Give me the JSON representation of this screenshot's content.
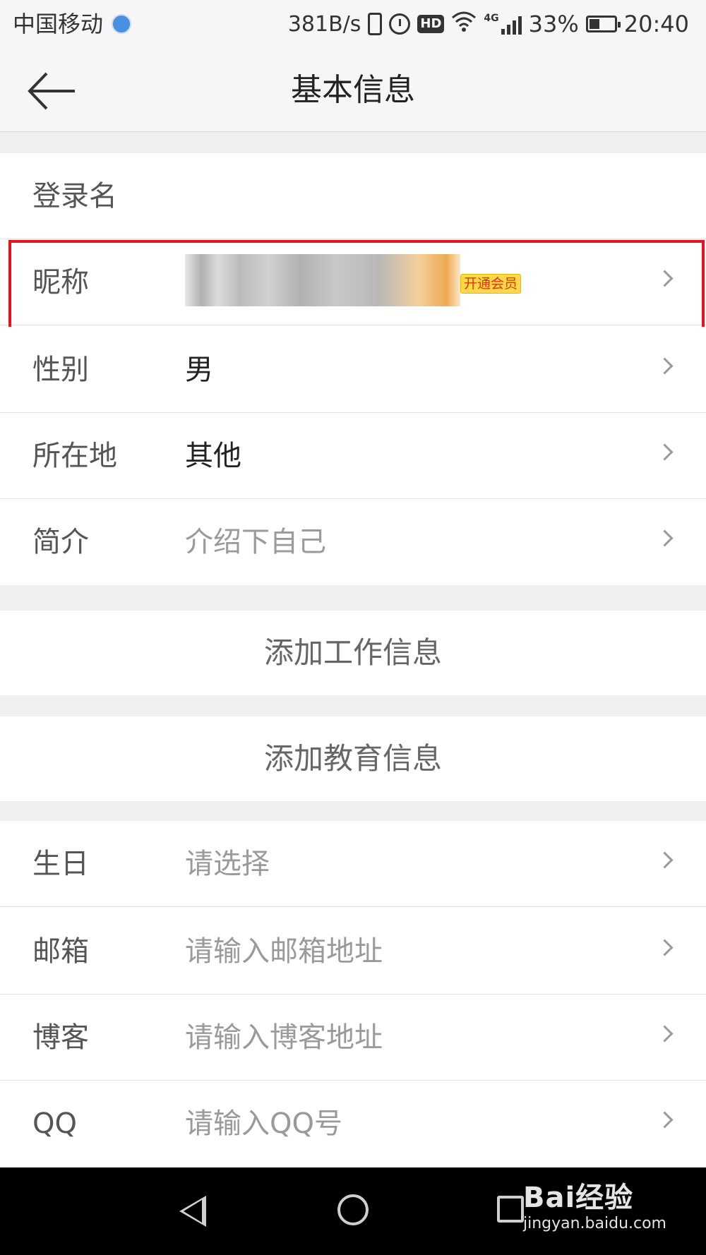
{
  "status_bar": {
    "carrier": "中国移动",
    "net_speed": "381B/s",
    "hd": "HD",
    "network_type": "4G",
    "battery": "33%",
    "time": "20:40"
  },
  "header": {
    "title": "基本信息"
  },
  "basic": {
    "login_label": "登录名",
    "nickname_label": "昵称",
    "vip_badge": "开通会员",
    "gender_label": "性别",
    "gender_value": "男",
    "location_label": "所在地",
    "location_value": "其他",
    "intro_label": "简介",
    "intro_placeholder": "介绍下自己"
  },
  "actions": {
    "add_work": "添加工作信息",
    "add_education": "添加教育信息"
  },
  "extra": {
    "birthday_label": "生日",
    "birthday_placeholder": "请选择",
    "email_label": "邮箱",
    "email_placeholder": "请输入邮箱地址",
    "blog_label": "博客",
    "blog_placeholder": "请输入博客地址",
    "qq_label": "QQ",
    "qq_placeholder": "请输入QQ号"
  },
  "watermark": {
    "main": "Bai经验",
    "sub": "jingyan.baidu.com"
  },
  "colors": {
    "highlight": "#e8121e",
    "vip_badge": "#ffd84a",
    "page_bg": "#efefef"
  },
  "icons": [
    "location-icon",
    "vibrate-icon",
    "alarm-icon",
    "wifi-icon",
    "signal-icon",
    "battery-icon",
    "back-arrow-icon",
    "chevron-right-icon",
    "nav-back-icon",
    "nav-home-icon",
    "nav-recent-icon"
  ]
}
